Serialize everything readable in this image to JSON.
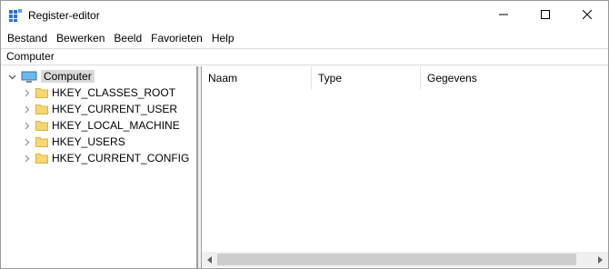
{
  "window": {
    "title": "Register-editor"
  },
  "menu": [
    "Bestand",
    "Bewerken",
    "Beeld",
    "Favorieten",
    "Help"
  ],
  "address": {
    "path": "Computer"
  },
  "tree": {
    "root": "Computer",
    "children": [
      "HKEY_CLASSES_ROOT",
      "HKEY_CURRENT_USER",
      "HKEY_LOCAL_MACHINE",
      "HKEY_USERS",
      "HKEY_CURRENT_CONFIG"
    ]
  },
  "list": {
    "columns": [
      "Naam",
      "Type",
      "Gegevens"
    ]
  },
  "colors": {
    "folder": "#f6d770",
    "selected": "#d9d9d9"
  }
}
